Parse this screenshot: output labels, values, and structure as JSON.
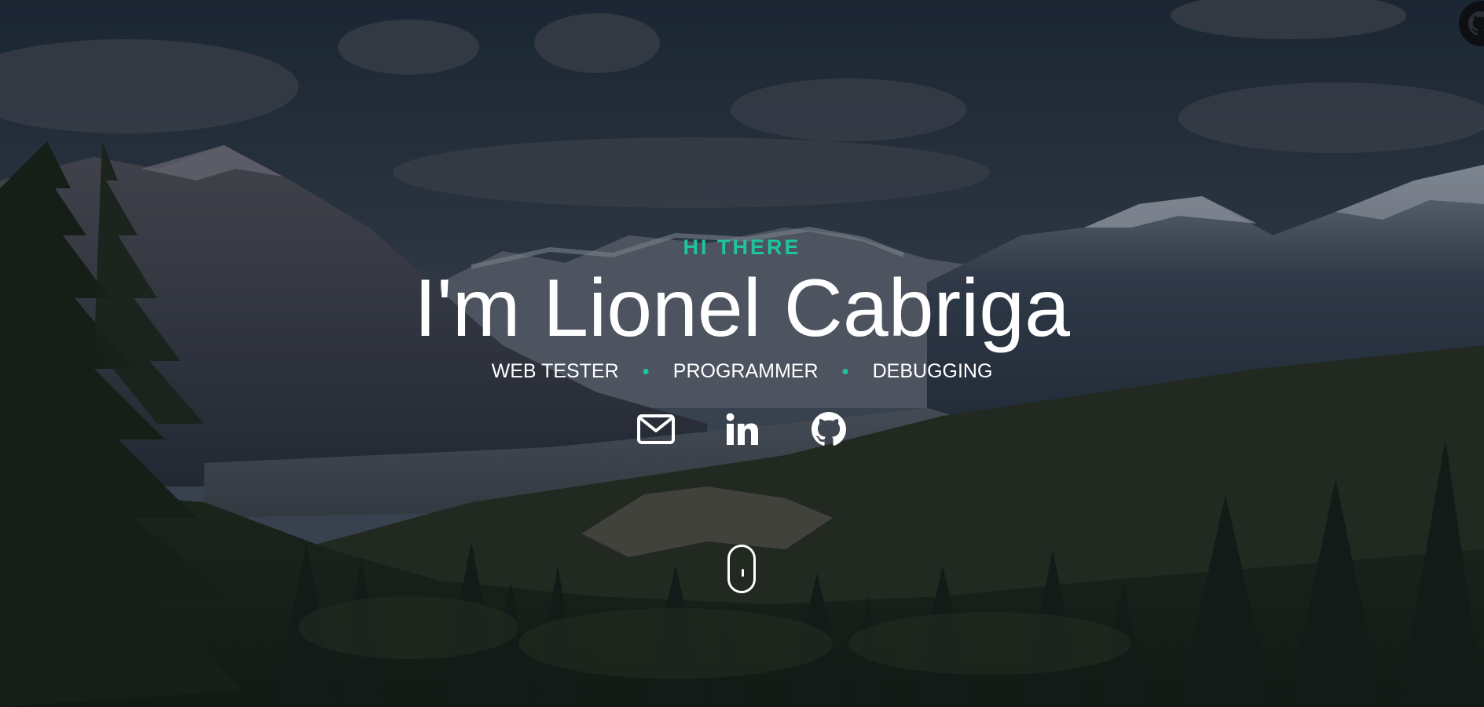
{
  "hero": {
    "greeting": "HI THERE",
    "title": "I'm Lionel Cabriga",
    "roles": [
      "WEB TESTER",
      "PROGRAMMER",
      "DEBUGGING"
    ],
    "separator": "•",
    "accent_color": "#1ec3a0"
  },
  "socials": [
    {
      "name": "email",
      "icon": "envelope-icon"
    },
    {
      "name": "linkedin",
      "icon": "linkedin-icon"
    },
    {
      "name": "github",
      "icon": "github-icon"
    }
  ],
  "corner": {
    "icon": "github-corner-icon"
  },
  "scroll_indicator": {
    "icon": "mouse-scroll-icon"
  }
}
